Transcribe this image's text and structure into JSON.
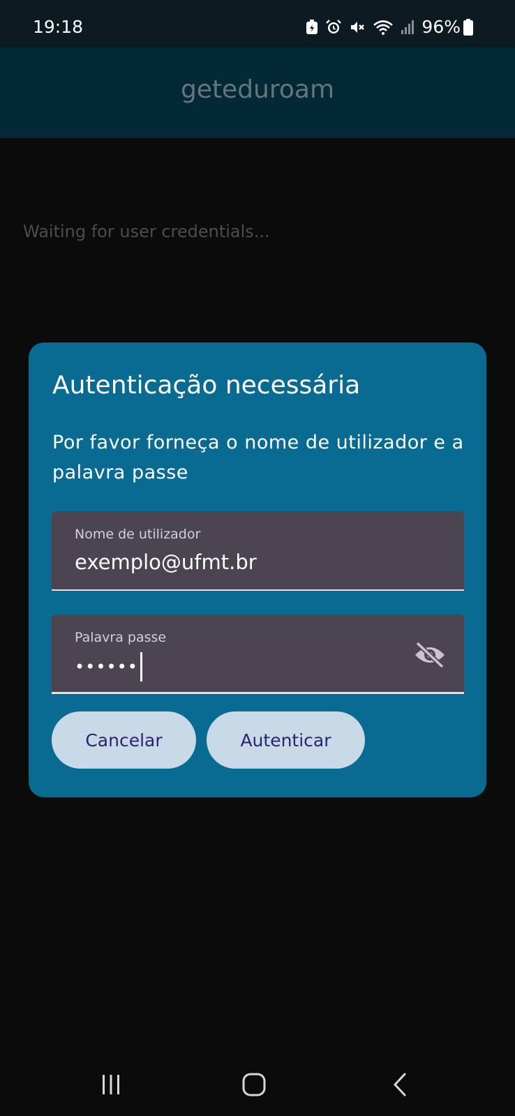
{
  "status_bar": {
    "time": "19:18",
    "battery_percent": "96%",
    "icons": [
      "battery-saver-icon",
      "alarm-icon",
      "mute-icon",
      "wifi-icon",
      "signal-icon",
      "battery-icon"
    ]
  },
  "app_bar": {
    "title": "geteduroam"
  },
  "main": {
    "status_text": "Waiting for user credentials..."
  },
  "dialog": {
    "title": "Autenticação necessária",
    "message": "Por favor forneça o nome de utilizador e a palavra passe",
    "username": {
      "label": "Nome de utilizador",
      "value": "exemplo@ufmt.br"
    },
    "password": {
      "label": "Palavra passe",
      "masked_value": "••••••",
      "toggle_icon": "visibility-off-icon"
    },
    "cancel_label": "Cancelar",
    "auth_label": "Autenticar"
  },
  "nav_bar": {
    "buttons": [
      "recents-icon",
      "home-icon",
      "back-icon"
    ]
  },
  "colors": {
    "app_bar": "#032836",
    "dialog_bg": "#0a6b92",
    "field_bg": "#4a4550",
    "button_bg": "#c8d9e7",
    "button_text": "#2e2370"
  }
}
